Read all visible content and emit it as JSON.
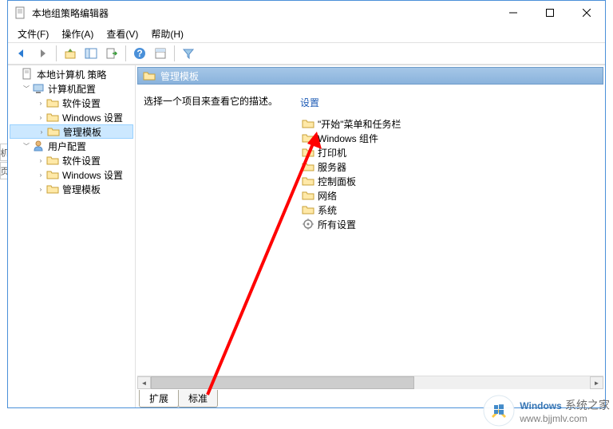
{
  "window": {
    "title": "本地组策略编辑器"
  },
  "menu": {
    "file": "文件(F)",
    "action": "操作(A)",
    "view": "查看(V)",
    "help": "帮助(H)"
  },
  "tree": {
    "root": "本地计算机 策略",
    "computer": "计算机配置",
    "software1": "软件设置",
    "windows1": "Windows 设置",
    "admin1": "管理模板",
    "user": "用户配置",
    "software2": "软件设置",
    "windows2": "Windows 设置",
    "admin2": "管理模板"
  },
  "breadcrumb": {
    "label": "管理模板"
  },
  "details": {
    "prompt": "选择一个项目来查看它的描述。",
    "settings_header": "设置"
  },
  "items": {
    "start": "\"开始\"菜单和任务栏",
    "wincomp": "Windows 组件",
    "printer": "打印机",
    "server": "服务器",
    "cpanel": "控制面板",
    "network": "网络",
    "system": "系统",
    "all": "所有设置"
  },
  "tabs": {
    "extended": "扩展",
    "standard": "标准"
  },
  "outer": {
    "t1": "机",
    "t2": "页"
  },
  "watermark": {
    "brand_en": "Windows",
    "brand_zh": "系统之家",
    "url": "www.bjjmlv.com"
  }
}
